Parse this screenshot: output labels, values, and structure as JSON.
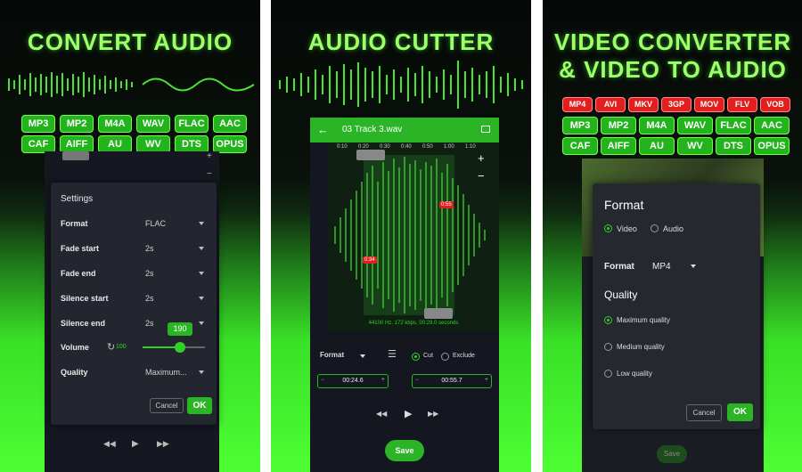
{
  "panel1": {
    "headline": "CONVERT AUDIO",
    "formats_row1": [
      "MP3",
      "MP2",
      "M4A",
      "WAV",
      "FLAC",
      "AAC"
    ],
    "formats_row2": [
      "CAF",
      "AIFF",
      "AU",
      "WV",
      "DTS",
      "OPUS"
    ],
    "dialog": {
      "title": "Settings",
      "rows": [
        {
          "label": "Format",
          "value": "FLAC"
        },
        {
          "label": "Fade start",
          "value": "2s"
        },
        {
          "label": "Fade end",
          "value": "2s"
        },
        {
          "label": "Silence start",
          "value": "2s"
        },
        {
          "label": "Silence end",
          "value": "2s"
        }
      ],
      "volume_label": "Volume",
      "volume_value": "190",
      "volume_reset": "100",
      "volume_level": 0.6,
      "quality_label": "Quality",
      "quality_value": "Maximum...",
      "cancel": "Cancel",
      "ok": "OK"
    }
  },
  "panel2": {
    "headline": "AUDIO CUTTER",
    "track_title": "03 Track 3.wav",
    "timeline": [
      "0:10",
      "0:20",
      "0:30",
      "0:40",
      "0:50",
      "1:00",
      "1:10"
    ],
    "marker_end": "0:55",
    "marker_start": "0:34",
    "info": "44100 Hz, 172 kbps, 00:29.0 seconds",
    "format_label": "Format",
    "cut_label": "Cut",
    "exclude_label": "Exclude",
    "start_time": "00:24.6",
    "end_time": "00:55.7",
    "save": "Save"
  },
  "panel3": {
    "headline_line1": "VIDEO CONVERTER",
    "headline_line2": "& VIDEO TO AUDIO",
    "video_formats": [
      "MP4",
      "AVI",
      "MKV",
      "3GP",
      "MOV",
      "FLV",
      "VOB"
    ],
    "formats_row1": [
      "MP3",
      "MP2",
      "M4A",
      "WAV",
      "FLAC",
      "AAC"
    ],
    "formats_row2": [
      "CAF",
      "AIFF",
      "AU",
      "WV",
      "DTS",
      "OPUS"
    ],
    "dialog": {
      "title": "Format",
      "video_option": "Video",
      "audio_option": "Audio",
      "format_label": "Format",
      "format_value": "MP4",
      "quality_title": "Quality",
      "quality_options": [
        "Maximum quality",
        "Medium quality",
        "Low quality"
      ],
      "cancel": "Cancel",
      "ok": "OK"
    },
    "save": "Save"
  },
  "colors": {
    "accent": "#2bb526",
    "headline": "#9dff6a",
    "red_chip": "#e21e1e"
  }
}
